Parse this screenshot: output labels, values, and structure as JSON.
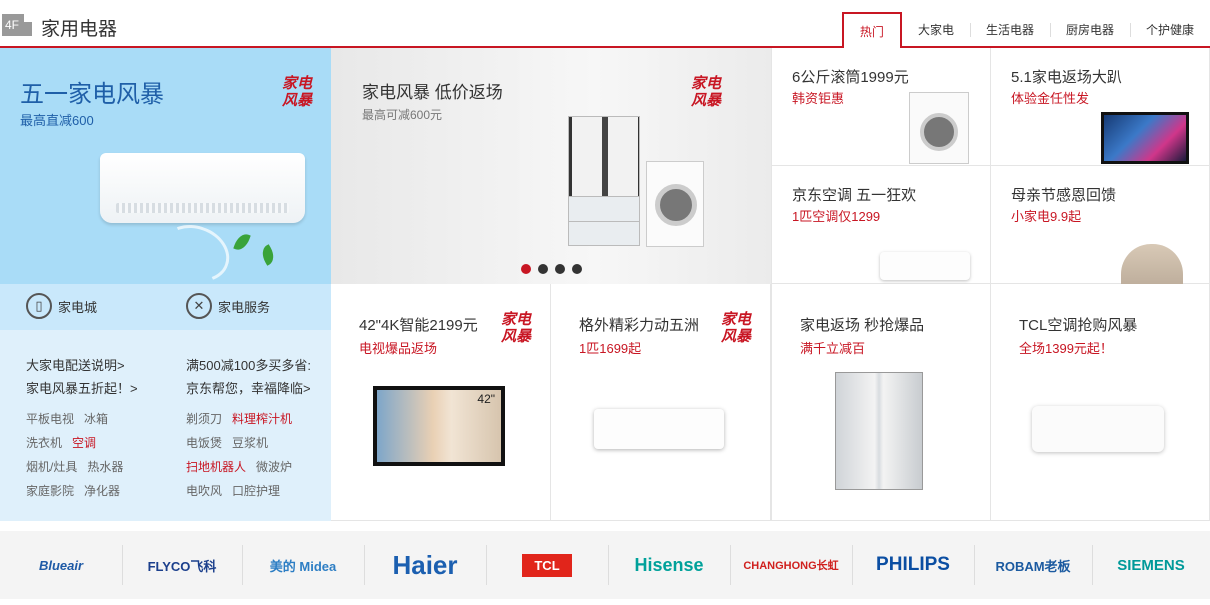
{
  "header": {
    "floor": "4F",
    "title": "家用电器",
    "tabs": [
      "热门",
      "大家电",
      "生活电器",
      "厨房电器",
      "个护健康"
    ]
  },
  "badge_text": [
    "家电",
    "风暴"
  ],
  "left": {
    "promo_title": "五一家电风暴",
    "promo_sub": "最高直减600",
    "services": [
      {
        "label": "家电城",
        "icon": "fridge-icon"
      },
      {
        "label": "家电服务",
        "icon": "tools-icon"
      }
    ],
    "links_col1": [
      "大家电配送说明>",
      "家电风暴五折起！>"
    ],
    "links_col2": [
      "满500减100多买多省:",
      "京东帮您，幸福降临>"
    ],
    "categories_col1": [
      [
        "平板电视",
        "冰箱"
      ],
      [
        "洗衣机",
        "空调"
      ],
      [
        "烟机/灶具",
        "热水器"
      ],
      [
        "家庭影院",
        "净化器"
      ]
    ],
    "categories_col2": [
      [
        "剃须刀",
        "料理榨汁机"
      ],
      [
        "电饭煲",
        "豆浆机"
      ],
      [
        "扫地机器人",
        "微波炉"
      ],
      [
        "电吹风",
        "口腔护理"
      ]
    ],
    "highlight_color": "#c81623"
  },
  "center": {
    "title": "家电风暴 低价返场",
    "sub": "最高可减600元",
    "slide_count": 4,
    "active_slide": 1
  },
  "right_cells": [
    {
      "title": "6公斤滚筒1999元",
      "sub": "韩资钜惠"
    },
    {
      "title": "5.1家电返场大趴",
      "sub": "体验金任性发"
    },
    {
      "title": "京东空调 五一狂欢",
      "sub": "1匹空调仅1299"
    },
    {
      "title": "母亲节感恩回馈",
      "sub": "小家电9.9起"
    }
  ],
  "bottom_cells": [
    {
      "title": "42\"4K智能2199元",
      "sub": "电视爆品返场",
      "tv_label": "42\""
    },
    {
      "title": "格外精彩力动五洲",
      "sub": "1匹1699起"
    },
    {
      "title": "家电返场 秒抢爆品",
      "sub": "满千立减百"
    },
    {
      "title": "TCL空调抢购风暴",
      "sub": "全场1399元起！"
    }
  ],
  "brands": [
    "Blueair",
    "FLYCO飞科",
    "美的 Midea",
    "Haier",
    "TCL",
    "Hisense",
    "CHANGHONG长虹",
    "PHILIPS",
    "ROBAM老板",
    "SIEMENS"
  ],
  "colors": {
    "accent": "#c81623",
    "promo_blue": "#1f5fa8",
    "light_blue": "#dff0fb"
  }
}
